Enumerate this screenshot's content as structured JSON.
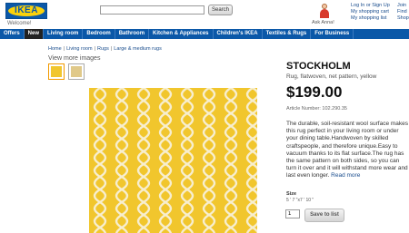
{
  "header": {
    "logo_text": "IKEA",
    "welcome": "Welcome!",
    "search": {
      "value": "",
      "button_label": "Search"
    },
    "ask_anna": "Ask Anna!",
    "account_links": [
      "Log In or Sign Up",
      "My shopping cart",
      "My shopping list"
    ],
    "right_links": [
      "Join",
      "Find",
      "Shop"
    ]
  },
  "nav": {
    "items": [
      "Offers",
      "New",
      "Living room",
      "Bedroom",
      "Bathroom",
      "Kitchen & Appliances",
      "Children's IKEA",
      "Textiles & Rugs",
      "For Business"
    ]
  },
  "breadcrumb": [
    "Home",
    "Living room",
    "Rugs",
    "Large & medium rugs"
  ],
  "gallery": {
    "view_more": "View more images"
  },
  "product": {
    "name": "STOCKHOLM",
    "description": "Rug, flatwoven, net pattern, yellow",
    "price": "$199.00",
    "article": "Article Number: 102.290.35",
    "long_description": "The durable, soil-resistant wool surface makes this rug perfect in your living room or under your dining table.Handwoven by skilled craftspeople, and therefore unique.Easy to vacuum thanks to its flat surface.The rug has the same pattern on both sides, so you can turn it over and it will withstand more wear and last even longer.",
    "read_more": "Read more",
    "size_label": "Size",
    "size_value": "5 ' 7 \"x7 ' 10 \"",
    "quantity": "1",
    "save_label": "Save to list"
  },
  "colors": {
    "nav_blue": "#0b58a8",
    "logo_yellow": "#fcd20a",
    "rug_yellow": "#f1c62d"
  }
}
